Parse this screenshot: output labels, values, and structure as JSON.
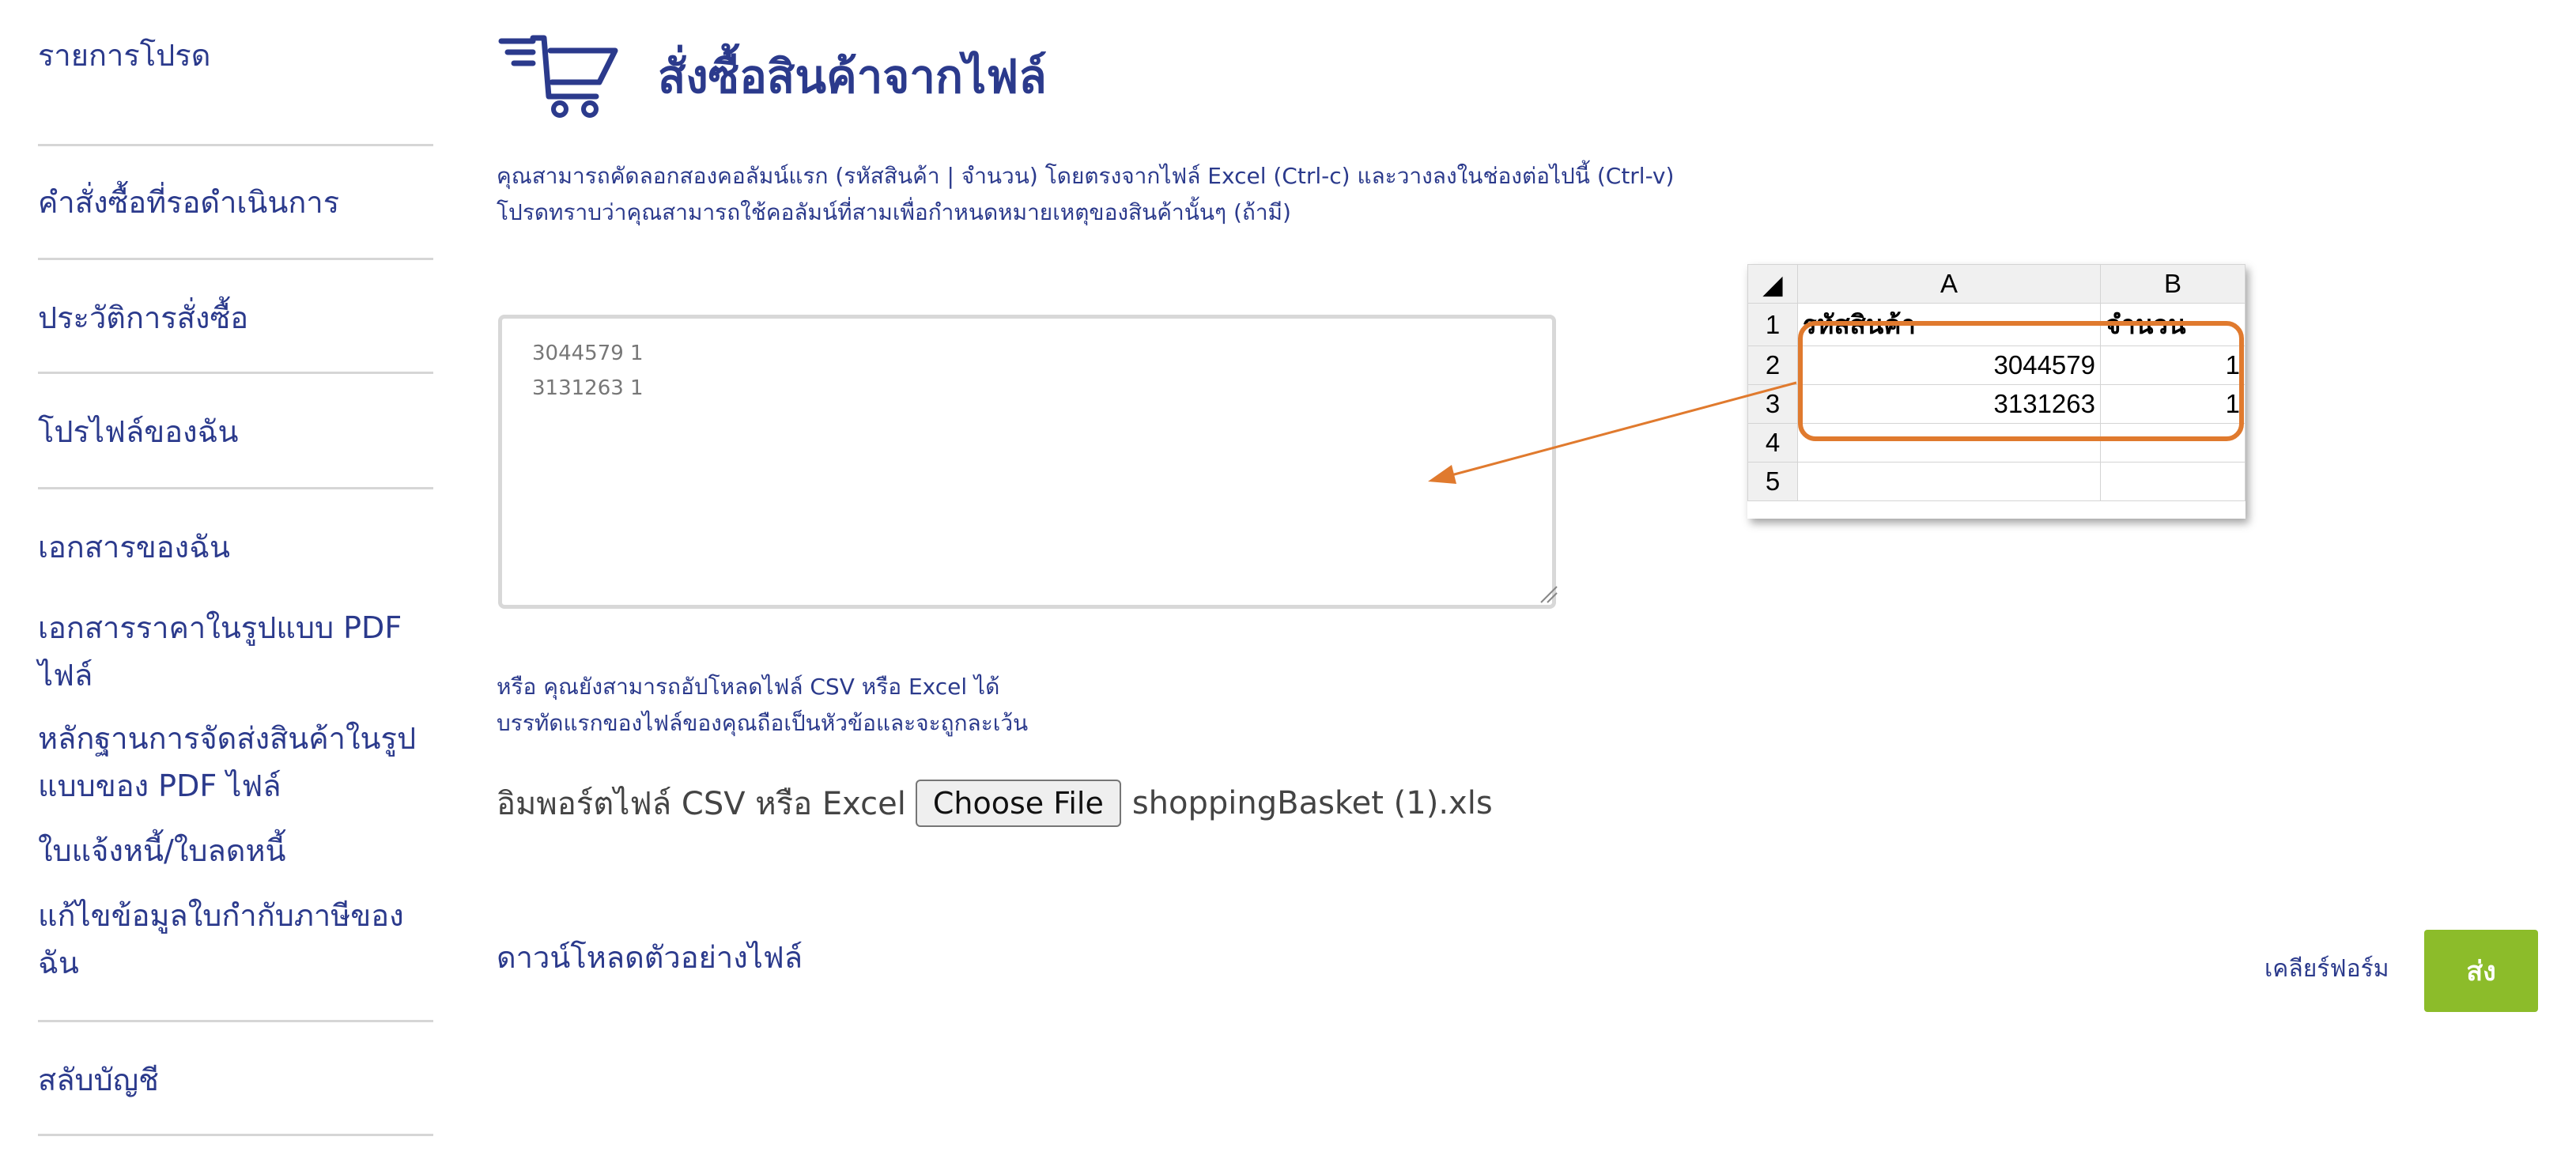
{
  "sidebar": {
    "items": [
      {
        "label": "รายการโปรด"
      },
      {
        "label": "คำสั่งซื้อที่รอดำเนินการ"
      },
      {
        "label": "ประวัติการสั่งซื้อ"
      },
      {
        "label": "โปรไฟล์ของฉัน"
      },
      {
        "label": "เอกสารของฉัน"
      },
      {
        "label": "เอกสารราคาในรูปแบบ PDF ไฟล์"
      },
      {
        "label": "หลักฐานการจัดส่งสินค้าในรูปแบบของ PDF ไฟล์"
      },
      {
        "label": "ใบแจ้งหนี้/ใบลดหนี้"
      },
      {
        "label": "แก้ไขข้อมูลใบกำกับภาษีของฉัน"
      },
      {
        "label": "สลับบัญชี"
      }
    ]
  },
  "header": {
    "title": "สั่งซื้อสินค้าจากไฟล์",
    "icon": "shopping-cart-icon"
  },
  "instructions": {
    "line1": "คุณสามารถคัดลอกสองคอลัมน์แรก (รหัสสินค้า | จำนวน) โดยตรงจากไฟล์ Excel (Ctrl-c) และวางลงในช่องต่อไปนี้ (Ctrl-v)",
    "line2": "โปรดทราบว่าคุณสามารถใช้คอลัมน์ที่สามเพื่อกำหนดหมายเหตุของสินค้านั้นๆ (ถ้ามี)"
  },
  "paste_area": {
    "value": "3044579 1\n3131263 1"
  },
  "excel_example": {
    "columns": [
      "A",
      "B"
    ],
    "row_numbers": [
      "1",
      "2",
      "3",
      "4",
      "5"
    ],
    "header_row": [
      "รหัสสินค้า",
      "จำนวน"
    ],
    "rows": [
      [
        "3044579",
        "1"
      ],
      [
        "3131263",
        "1"
      ]
    ],
    "highlight_color": "#e07a2e"
  },
  "alternative": {
    "line1": "หรือ คุณยังสามารถอัปโหลดไฟล์ CSV หรือ Excel ได้",
    "line2": "บรรทัดแรกของไฟล์ของคุณถือเป็นหัวข้อและจะถูกละเว้น"
  },
  "import": {
    "label": "อิมพอร์ตไฟล์ CSV หรือ Excel",
    "button": "Choose File",
    "file_name": "shoppingBasket (1).xls"
  },
  "download_sample": "ดาวน์โหลดตัวอย่างไฟล์",
  "actions": {
    "clear": "เคลียร์ฟอร์ม",
    "submit": "ส่ง",
    "submit_color": "#8cbc2a"
  }
}
